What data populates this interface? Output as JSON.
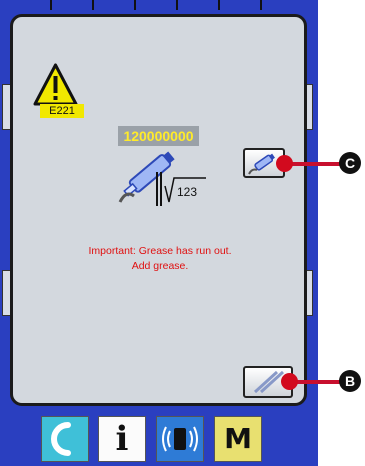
{
  "error": {
    "code": "E221",
    "counter_value": "120000000",
    "icon": "warning-triangle-icon",
    "message_line1": "Important: Grease has run out.",
    "message_line2": "Add grease."
  },
  "buttons": {
    "grease_button_icon": "grease-tube-icon",
    "reset_button_icon": "slash-reset-icon"
  },
  "callouts": {
    "grease_label": "C",
    "reset_label": "B"
  },
  "bottom_bar": {
    "return_icon": "return-arrow-icon",
    "info_label": "i",
    "communication_icon": "communication-icon",
    "mode_label": "M"
  },
  "colors": {
    "screen_blue": "#2a3fc0",
    "dialog_gray": "#d3d8de",
    "message_red": "#e01010",
    "error_code_yellow": "#f1e800",
    "counter_text_yellow": "#ffeb2a",
    "callout_red": "#d20a1e"
  }
}
